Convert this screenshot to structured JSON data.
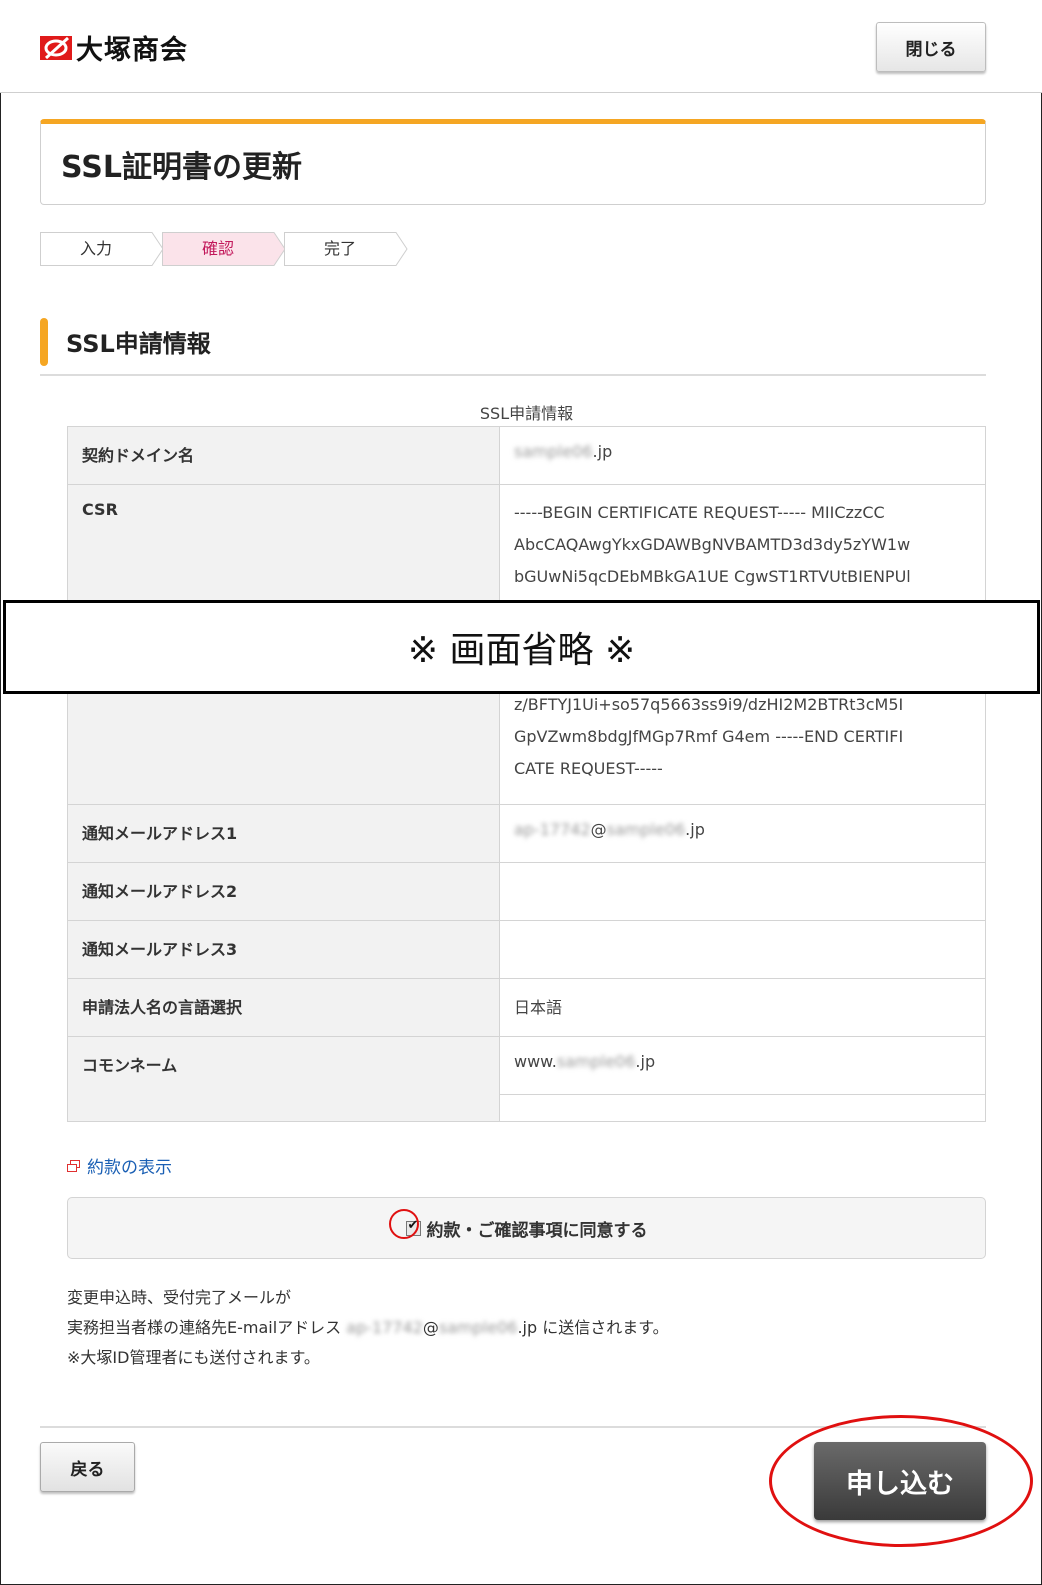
{
  "header": {
    "logo_text": "大塚商会",
    "close_label": "閉じる"
  },
  "page": {
    "title": "SSL証明書の更新"
  },
  "steps": [
    {
      "label": "入力",
      "active": false
    },
    {
      "label": "確認",
      "active": true
    },
    {
      "label": "完了",
      "active": false
    }
  ],
  "section": {
    "title": "SSL申請情報",
    "table_caption": "SSL申請情報"
  },
  "table": {
    "domain": {
      "label": "契約ドメイン名",
      "value_blurred": "sample06",
      "value_suffix": ".jp"
    },
    "csr": {
      "label": "CSR",
      "lines_top": [
        "-----BEGIN CERTIFICATE REQUEST----- MIICzzCC",
        "AbcCAQAwgYkxGDAWBgNVBAMTD3d3dy5zYW1w",
        "bGUwNi5qcDEbMBkGA1UE CgwST1RTVUtBIENPUl"
      ],
      "lines_bottom": [
        "z/BFTYJ1Ui+so57q5663ss9i9/dzHI2M2BTRt3cM5I",
        "GpVZwm8bdgJfMGp7Rmf G4em -----END CERTIFI",
        "CATE REQUEST-----"
      ]
    },
    "mail1": {
      "label": "通知メールアドレス1",
      "value_blurred": "ap-17742",
      "value_at": "@",
      "value_blurred2": "sample06",
      "value_suffix": ".jp"
    },
    "mail2": {
      "label": "通知メールアドレス2",
      "value": ""
    },
    "mail3": {
      "label": "通知メールアドレス3",
      "value": ""
    },
    "lang": {
      "label": "申請法人名の言語選択",
      "value": "日本語"
    },
    "common_name": {
      "label": "コモンネーム",
      "value_prefix": "www.",
      "value_blurred": "sample06",
      "value_suffix": ".jp"
    }
  },
  "overlay": {
    "text": "※ 画面省略 ※"
  },
  "terms": {
    "link_label": "約款の表示",
    "agree_label": "約款・ご確認事項に同意する",
    "agreed": true
  },
  "notice": {
    "line1": "変更申込時、受付完了メールが",
    "line2_prefix": "実務担当者様の連絡先E-mailアドレス ",
    "line2_blurred": "ap-17742",
    "line2_at": "@",
    "line2_blurred2": "sample06",
    "line2_suffix": ".jp に送信されます。",
    "line3": "※大塚ID管理者にも送付されます。"
  },
  "footer": {
    "back_label": "戻る",
    "submit_label": "申し込む"
  },
  "colors": {
    "accent": "#f5a623",
    "step_active_bg": "#fbe3ea",
    "step_active_text": "#c2185b",
    "link": "#1a5fb4",
    "annotation_red": "#e01010"
  }
}
